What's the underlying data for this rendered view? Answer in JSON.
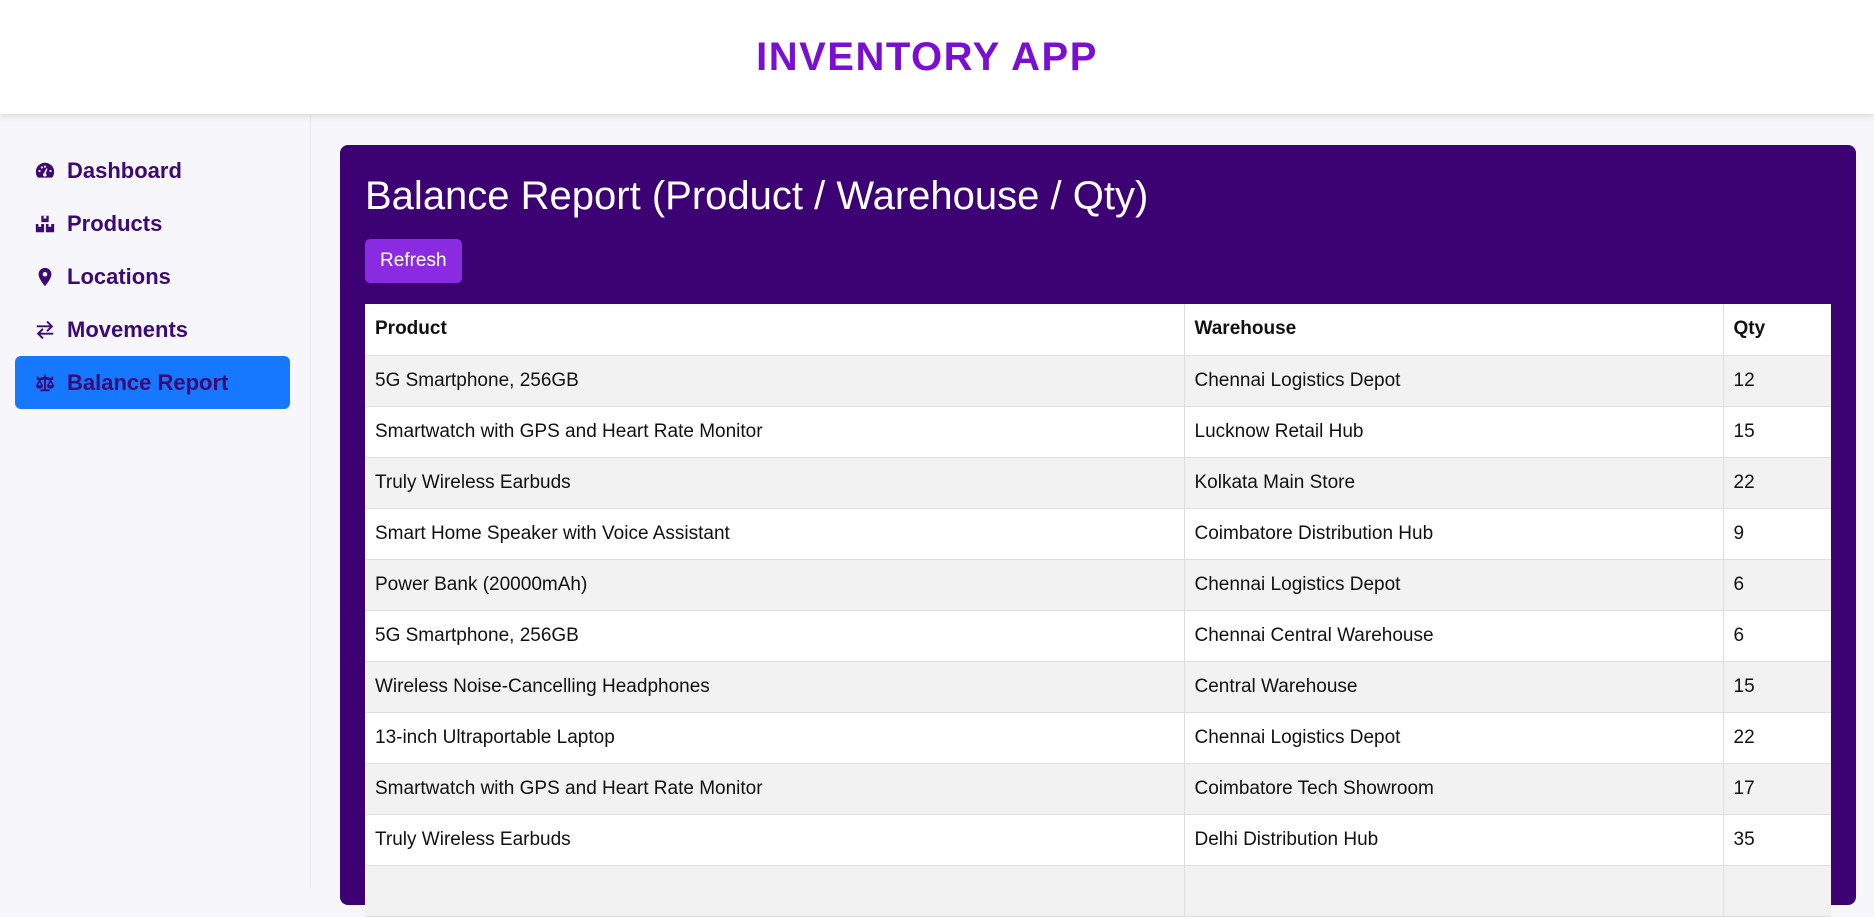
{
  "header": {
    "title": "INVENTORY APP"
  },
  "sidebar": {
    "items": [
      {
        "label": "Dashboard",
        "icon": "dashboard-gauge-icon"
      },
      {
        "label": "Products",
        "icon": "boxes-icon"
      },
      {
        "label": "Locations",
        "icon": "map-pin-icon"
      },
      {
        "label": "Movements",
        "icon": "arrows-exchange-icon"
      },
      {
        "label": "Balance Report",
        "icon": "scale-balance-icon",
        "active": true
      }
    ]
  },
  "report": {
    "title": "Balance Report (Product / Warehouse / Qty)",
    "refresh_label": "Refresh",
    "columns": [
      "Product",
      "Warehouse",
      "Qty"
    ],
    "rows": [
      [
        "5G Smartphone, 256GB",
        "Chennai Logistics Depot",
        "12"
      ],
      [
        "Smartwatch with GPS and Heart Rate Monitor",
        "Lucknow Retail Hub",
        "15"
      ],
      [
        "Truly Wireless Earbuds",
        "Kolkata Main Store",
        "22"
      ],
      [
        "Smart Home Speaker with Voice Assistant",
        "Coimbatore Distribution Hub",
        "9"
      ],
      [
        "Power Bank (20000mAh)",
        "Chennai Logistics Depot",
        "6"
      ],
      [
        "5G Smartphone, 256GB",
        "Chennai Central Warehouse",
        "6"
      ],
      [
        "Wireless Noise-Cancelling Headphones",
        "Central Warehouse",
        "15"
      ],
      [
        "13-inch Ultraportable Laptop",
        "Chennai Logistics Depot",
        "22"
      ],
      [
        "Smartwatch with GPS and Heart Rate Monitor",
        "Coimbatore Tech Showroom",
        "17"
      ],
      [
        "Truly Wireless Earbuds",
        "Delhi Distribution Hub",
        "35"
      ],
      [
        "",
        "",
        ""
      ]
    ]
  },
  "colors": {
    "brand": "#7a0fd2",
    "card_bg": "#3c0273",
    "active_nav": "#1677ff",
    "refresh_button": "#8a2be2"
  }
}
